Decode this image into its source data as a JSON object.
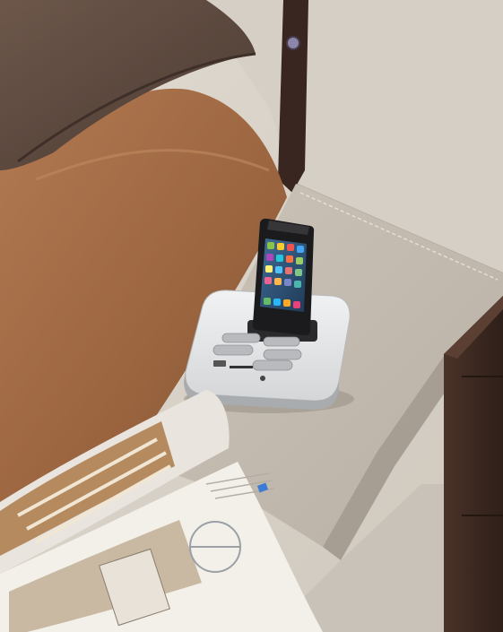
{
  "scene": {
    "description_alt": "",
    "colors": {
      "wall": "#d9d3ca",
      "bed_frame": "#c6bdb2",
      "bedding_brown": "#a06a45",
      "pillow_dark": "#5e4a40",
      "strap": "#3a2620",
      "nightstand": "#3b2820",
      "dock": "#e6e7e8",
      "phone": "#1b1b1d",
      "magazine_page": "#f1eee8"
    },
    "dock": {
      "buttons": [
        "minus",
        "plus",
        "prev",
        "next",
        "play",
        "vol"
      ]
    }
  }
}
